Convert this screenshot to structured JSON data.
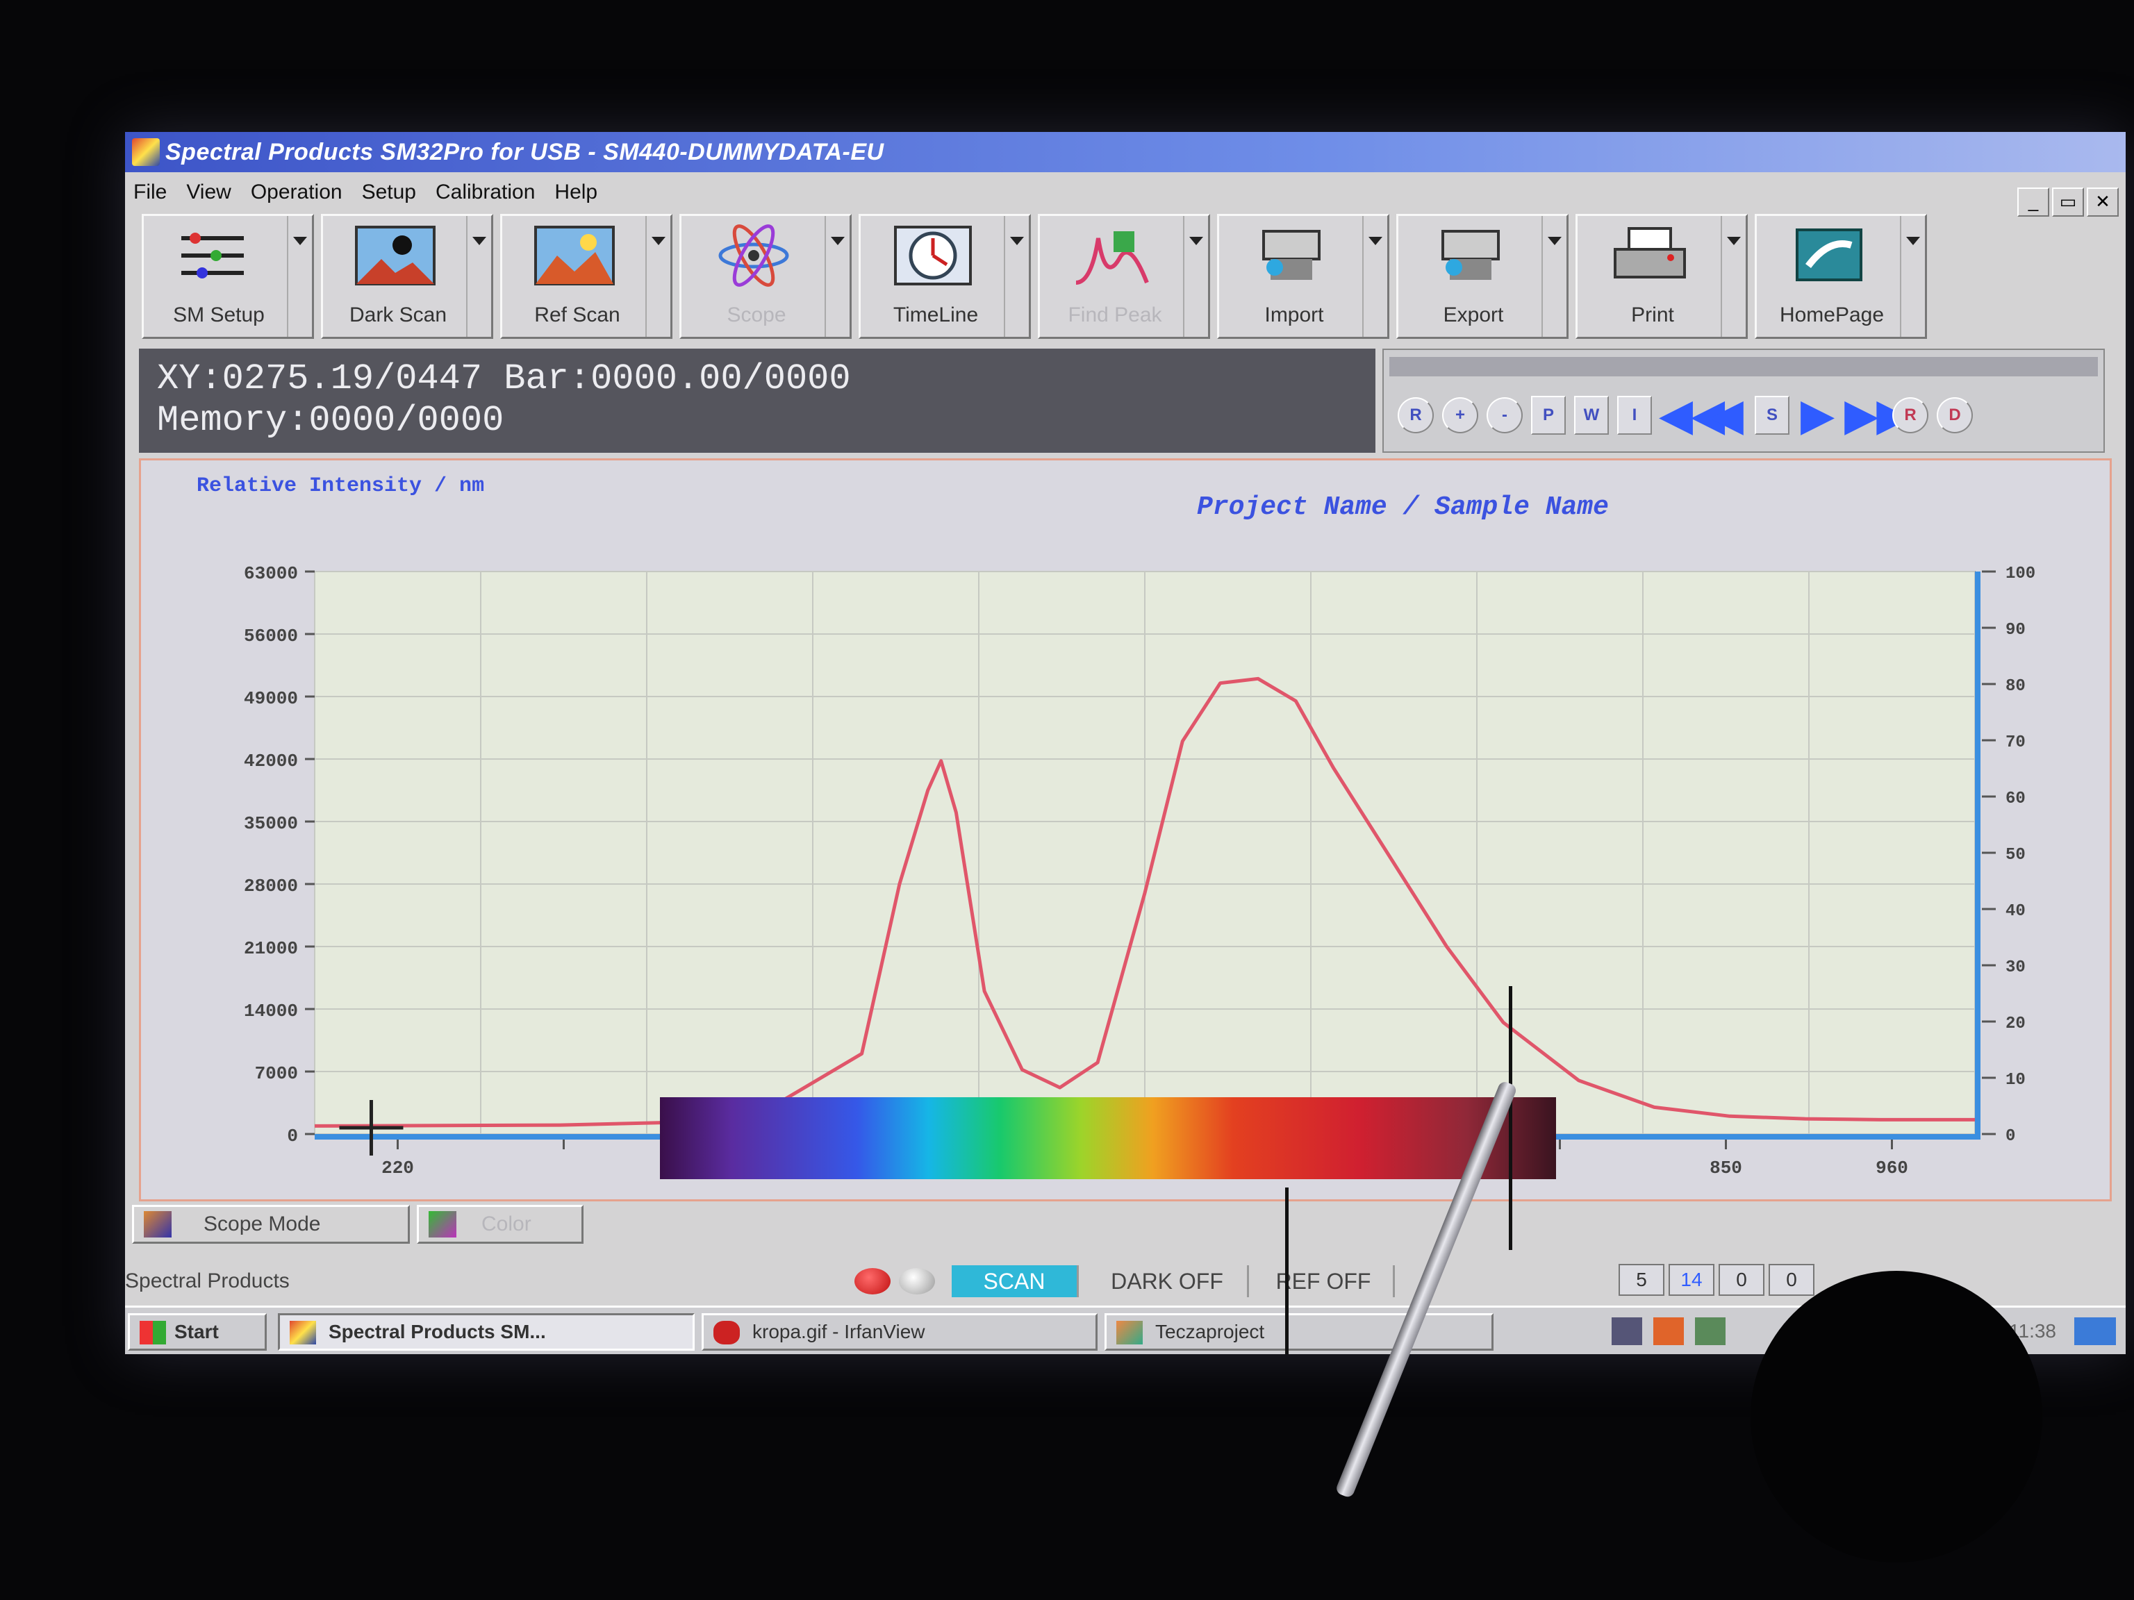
{
  "window": {
    "title": "Spectral Products SM32Pro for USB - SM440-DUMMYDATA-EU",
    "controls": [
      "_",
      "▭",
      "✕"
    ]
  },
  "menu": [
    "File",
    "View",
    "Operation",
    "Setup",
    "Calibration",
    "Help"
  ],
  "toolbar": [
    {
      "id": "sm-setup",
      "label": "SM Setup",
      "enabled": true,
      "icon": "cables-icon"
    },
    {
      "id": "dark-scan",
      "label": "Dark Scan",
      "enabled": true,
      "icon": "dark-scan-icon"
    },
    {
      "id": "ref-scan",
      "label": "Ref Scan",
      "enabled": true,
      "icon": "ref-scan-icon"
    },
    {
      "id": "scope",
      "label": "Scope",
      "enabled": false,
      "icon": "atom-icon"
    },
    {
      "id": "timeline",
      "label": "TimeLine",
      "enabled": true,
      "icon": "clock-icon"
    },
    {
      "id": "find-peak",
      "label": "Find Peak",
      "enabled": false,
      "icon": "peak-icon"
    },
    {
      "id": "import",
      "label": "Import",
      "enabled": true,
      "icon": "import-icon"
    },
    {
      "id": "export",
      "label": "Export",
      "enabled": true,
      "icon": "export-icon"
    },
    {
      "id": "print",
      "label": "Print",
      "enabled": true,
      "icon": "printer-icon"
    },
    {
      "id": "homepage",
      "label": "HomePage",
      "enabled": true,
      "icon": "sp-logo-icon"
    }
  ],
  "readout": {
    "line1": "XY:0275.19/0447  Bar:0000.00/0000",
    "line2": "Memory:0000/0000"
  },
  "player": {
    "buttons": [
      "R",
      "+",
      "-",
      "P",
      "W",
      "I",
      "◀◀",
      "◀",
      "S",
      "▶",
      "▶▶",
      "R",
      "D"
    ]
  },
  "plot": {
    "y_axis_label": "Relative Intensity / nm",
    "title": "Project Name / Sample Name"
  },
  "chart_data": {
    "type": "line",
    "title": "Project Name / Sample Name",
    "ylabel": "Relative Intensity / nm",
    "xlabel": "",
    "x_ticks": [
      "220",
      "",
      "",
      "",
      "",
      "",
      "",
      "",
      "850",
      "960"
    ],
    "y_ticks": [
      0,
      7000,
      14000,
      21000,
      28000,
      35000,
      42000,
      49000,
      56000,
      63000
    ],
    "y2_ticks": [
      0,
      10,
      20,
      30,
      40,
      50,
      60,
      70,
      80,
      90,
      100
    ],
    "ylim": [
      0,
      63000
    ],
    "xlim": [
      170,
      1050
    ],
    "grid": true,
    "series": [
      {
        "color": "#e0566a",
        "x": [
          170,
          300,
          400,
          460,
          480,
          495,
          502,
          510,
          525,
          545,
          565,
          585,
          610,
          630,
          650,
          670,
          690,
          710,
          740,
          770,
          800,
          840,
          880,
          920,
          960,
          1000,
          1050
        ],
        "y": [
          900,
          1000,
          1500,
          9000,
          28000,
          38500,
          41800,
          36000,
          16000,
          7200,
          5200,
          8000,
          27000,
          44000,
          50500,
          51000,
          48500,
          41000,
          31000,
          21000,
          12500,
          6000,
          3000,
          2000,
          1700,
          1600,
          1600
        ]
      }
    ],
    "cursor": {
      "x": 200,
      "y": 700
    }
  },
  "mode": {
    "scope_tab": "Scope Mode",
    "color_tab": "Color"
  },
  "status": {
    "app_name": "Spectral Products",
    "scan": "SCAN",
    "dark": "DARK OFF",
    "ref": "REF OFF",
    "n1": "5",
    "n2": "14",
    "n3": "0",
    "n4": "0"
  },
  "taskbar": {
    "start": "Start",
    "tasks": [
      "Spectral Products SM...",
      "kropa.gif - IrfanView",
      "Teczaproject"
    ],
    "clock": "11:38"
  },
  "colors": {
    "title_start": "#3d55c8",
    "title_end": "#a9b9ee",
    "plot_bg": "#e5eadc",
    "plot_frame": "#e6a28d",
    "axis_blue": "#3a8fe0",
    "accent_blue": "#3b52e0",
    "scan_active": "#2fb8d8"
  }
}
